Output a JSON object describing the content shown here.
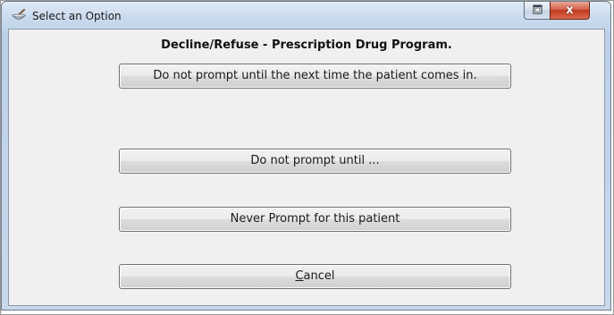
{
  "window": {
    "title": "Select an Option",
    "close_label": "x",
    "icon": "mortar-pestle-icon"
  },
  "dialog": {
    "heading": "Decline/Refuse - Prescription Drug Program.",
    "options": [
      {
        "label": "Do not prompt until the next time the patient comes in."
      },
      {
        "label": "Do not prompt until ..."
      },
      {
        "label": "Never Prompt for this patient"
      }
    ],
    "cancel": {
      "mnemonic": "C",
      "rest": "ancel"
    }
  }
}
